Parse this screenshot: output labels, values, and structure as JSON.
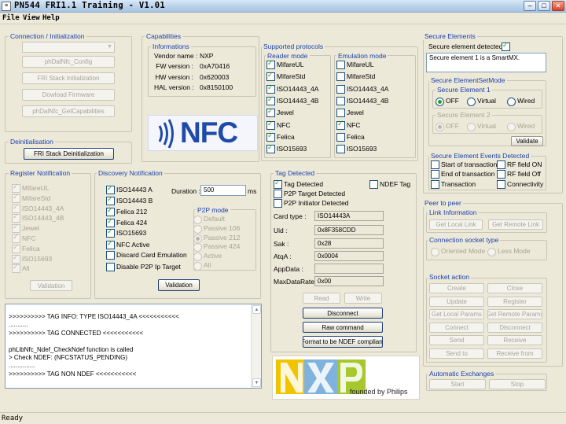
{
  "window": {
    "title": "PN544 FRI1.1 Training - V1.01",
    "status": "Ready"
  },
  "menu": [
    "File",
    "View",
    "Help"
  ],
  "connection": {
    "title": "Connection / Initialization",
    "buttons": [
      "phDalNfc_Config",
      "FRI Stack Initialization",
      "Dowload Firmware",
      "phDalNfc_GetCapabilities"
    ]
  },
  "deinit": {
    "title": "Deinitialisation",
    "button": "FRI Stack Deinitialization"
  },
  "capabilities": {
    "title": "Capabilities",
    "subtitle": "Informations",
    "rows": [
      {
        "label": "Vendor name :",
        "value": "NXP"
      },
      {
        "label": "FW version :",
        "value": "0xA70416"
      },
      {
        "label": "HW version :",
        "value": "0x620003"
      },
      {
        "label": "HAL version :",
        "value": "0x8150100"
      }
    ]
  },
  "nfc_logo_text": "NFC",
  "protocols": {
    "title": "Supported protocols",
    "reader_title": "Reader mode",
    "emulation_title": "Emulation mode",
    "reader": [
      {
        "label": "MifareUL",
        "checked": true
      },
      {
        "label": "MifareStd",
        "checked": true
      },
      {
        "label": "ISO14443_4A",
        "checked": true
      },
      {
        "label": "ISO14443_4B",
        "checked": true
      },
      {
        "label": "Jewel",
        "checked": true
      },
      {
        "label": "NFC",
        "checked": true
      },
      {
        "label": "Felica",
        "checked": true
      },
      {
        "label": "ISO15693",
        "checked": true
      }
    ],
    "emulation": [
      {
        "label": "MifareUL",
        "checked": false
      },
      {
        "label": "MifareStd",
        "checked": false
      },
      {
        "label": "ISO14443_4A",
        "checked": false
      },
      {
        "label": "ISO14443_4B",
        "checked": false
      },
      {
        "label": "Jewel",
        "checked": false
      },
      {
        "label": "NFC",
        "checked": true
      },
      {
        "label": "Felica",
        "checked": false
      },
      {
        "label": "ISO15693",
        "checked": false
      }
    ]
  },
  "secure": {
    "title": "Secure Elements",
    "detected_label": "Secure element detected :",
    "detected": true,
    "info_text": "Secure element 1 is a SmartMX.",
    "setmode_title": "Secure ElementSetMode",
    "se1_title": "Secure Element 1",
    "se1_options": [
      "OFF",
      "Virtual",
      "Wired"
    ],
    "se2_title": "Secure Element 2",
    "se2_options": [
      "OFF",
      "Virtual",
      "Wired"
    ],
    "validate": "Validate",
    "events_title": "Secure Element Events Detected",
    "events": [
      "Start of transaction",
      "RF field ON",
      "End of transaction",
      "RF field Off",
      "Transaction",
      "Connectivity"
    ]
  },
  "register": {
    "title": "Register Notification",
    "items": [
      "MifareUL",
      "MifareStd",
      "ISO14443_4A",
      "ISO14443_4B",
      "Jewel",
      "NFC",
      "Felica",
      "ISO15693",
      "All"
    ],
    "button": "Validation"
  },
  "discovery": {
    "title": "Discovery Notification",
    "items": [
      {
        "label": "ISO14443 A",
        "checked": true
      },
      {
        "label": "ISO14443 B",
        "checked": true
      },
      {
        "label": "Felica 212",
        "checked": true
      },
      {
        "label": "Felica 424",
        "checked": true
      },
      {
        "label": "ISO15693",
        "checked": true
      },
      {
        "label": "NFC Active",
        "checked": true
      },
      {
        "label": "Discard Card Emulation",
        "checked": false
      },
      {
        "label": "Disable P2P Ip Target",
        "checked": false
      }
    ],
    "duration_label": "Duration :",
    "duration_value": "500",
    "duration_unit": "ms",
    "p2p_title": "P2P mode",
    "p2p_options": [
      "Default",
      "Passive 106",
      "Passive 212",
      "Passive 424",
      "Active",
      "All"
    ],
    "button": "Validation"
  },
  "tag": {
    "title": "Tag Detected",
    "flags": [
      {
        "label": "Tag Detected",
        "checked": true
      },
      {
        "label": "NDEF Tag",
        "checked": false
      },
      {
        "label": "P2P Target Detected",
        "checked": false
      },
      {
        "label": "P2P Initiator Detected",
        "checked": false
      }
    ],
    "fields": [
      {
        "label": "Card type :",
        "value": "ISO14443A"
      },
      {
        "label": "Uid :",
        "value": "0x8F358CDD"
      },
      {
        "label": "Sak :",
        "value": "0x28"
      },
      {
        "label": "AtqA :",
        "value": "0x0004"
      },
      {
        "label": "AppData :",
        "value": ""
      },
      {
        "label": "MaxDataRate :",
        "value": "0x00"
      }
    ],
    "read": "Read",
    "write": "Write",
    "disconnect": "Disconnect",
    "raw": "Raw command",
    "format": "Format to be NDEF compliant"
  },
  "log_lines": [
    ">>>>>>>>>> TAG INFO: TYPE ISO14443_4A <<<<<<<<<<<",
    "...........",
    ">>>>>>>>>> TAG CONNECTED <<<<<<<<<<<",
    "",
    "phLibNfc_Ndef_CheckNdef function is called",
    "> Check NDEF: (NFCSTATUS_PENDING)",
    "...............",
    ">>>>>>>>>> TAG NON NDEF <<<<<<<<<<<"
  ],
  "nxp_logo": {
    "text": "NXP",
    "subtext": "founded by Philips"
  },
  "p2p": {
    "title": "Peer to peer",
    "link_title": "Link Information",
    "link_buttons": [
      "Get Local Link",
      "Get Remote Link"
    ],
    "socket_type_title": "Connection socket type",
    "socket_types": [
      "Oriented Mode",
      "Less Mode"
    ],
    "socket_action_title": "Socket action",
    "actions": [
      "Create",
      "Close",
      "Update",
      "Register",
      "Get Local Params",
      "Get Remote Params",
      "Connect",
      "Disconnect",
      "Send",
      "Receive",
      "Send to",
      "Receive from"
    ]
  },
  "auto": {
    "title": "Automatic Exchanges",
    "buttons": [
      "Start",
      "Stop"
    ]
  },
  "colors": {
    "group_title": "#1a3fb0",
    "check": "#21a121",
    "nfc_blue": "#1e4aa8",
    "nxp_yellow": "#f1c400",
    "nxp_blue": "#7fb2dd",
    "nxp_green": "#a7c72e"
  }
}
